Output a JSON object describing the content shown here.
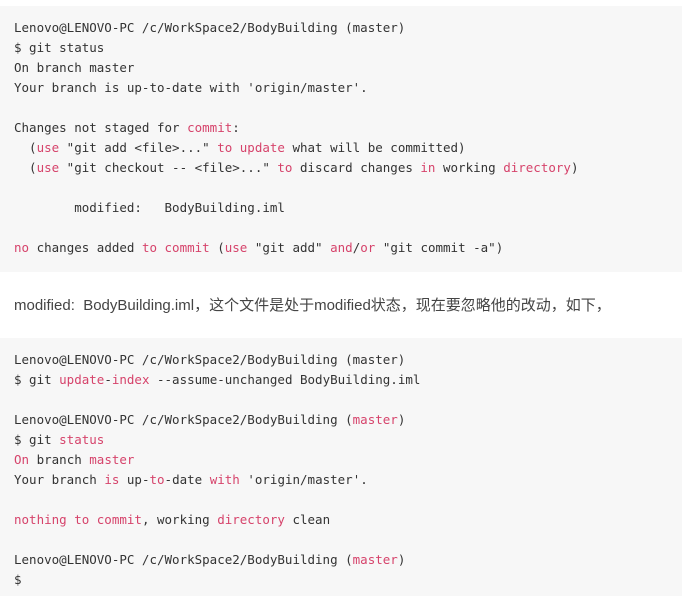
{
  "colors": {
    "code_background": "#f7f7f7",
    "page_background": "#ffffff",
    "code_text": "#333333",
    "keyword_highlight": "#d6436b",
    "prose_text": "#444444"
  },
  "code_block_1": {
    "name": "git-status-modified-output",
    "lines": [
      [
        {
          "t": "Lenovo@LENOVO-PC /c/WorkSpace2/BodyBuilding (master)",
          "k": false
        }
      ],
      [
        {
          "t": "$ git status",
          "k": false
        }
      ],
      [
        {
          "t": "On branch master",
          "k": false
        }
      ],
      [
        {
          "t": "Your branch is up-to-date with 'origin/master'.",
          "k": false
        }
      ],
      [],
      [
        {
          "t": "Changes not staged for ",
          "k": false
        },
        {
          "t": "commit",
          "k": true
        },
        {
          "t": ":",
          "k": false
        }
      ],
      [
        {
          "t": "  (",
          "k": false
        },
        {
          "t": "use",
          "k": true
        },
        {
          "t": " \"git add <file>...\" ",
          "k": false
        },
        {
          "t": "to update",
          "k": true
        },
        {
          "t": " what will be committed)",
          "k": false
        }
      ],
      [
        {
          "t": "  (",
          "k": false
        },
        {
          "t": "use",
          "k": true
        },
        {
          "t": " \"git checkout -- <file>...\" ",
          "k": false
        },
        {
          "t": "to",
          "k": true
        },
        {
          "t": " discard changes ",
          "k": false
        },
        {
          "t": "in",
          "k": true
        },
        {
          "t": " working ",
          "k": false
        },
        {
          "t": "directory",
          "k": true
        },
        {
          "t": ")",
          "k": false
        }
      ],
      [],
      [
        {
          "t": "        modified:   BodyBuilding.iml",
          "k": false
        }
      ],
      [],
      [
        {
          "t": "no",
          "k": true
        },
        {
          "t": " changes added ",
          "k": false
        },
        {
          "t": "to commit",
          "k": true
        },
        {
          "t": " (",
          "k": false
        },
        {
          "t": "use",
          "k": true
        },
        {
          "t": " \"git add\" ",
          "k": false
        },
        {
          "t": "and",
          "k": true
        },
        {
          "t": "/",
          "k": false
        },
        {
          "t": "or",
          "k": true
        },
        {
          "t": " \"git commit -a\")",
          "k": false
        }
      ]
    ]
  },
  "prose": {
    "text": "modified:  BodyBuilding.iml，这个文件是处于modified状态，现在要忽略他的改动，如下，"
  },
  "code_block_2": {
    "name": "git-update-index-assume-unchanged-output",
    "lines": [
      [
        {
          "t": "Lenovo@LENOVO-PC /c/WorkSpace2/BodyBuilding (master)",
          "k": false
        }
      ],
      [
        {
          "t": "$ git ",
          "k": false
        },
        {
          "t": "update",
          "k": true
        },
        {
          "t": "-",
          "k": false
        },
        {
          "t": "index",
          "k": true
        },
        {
          "t": " --assume-unchanged BodyBuilding.iml",
          "k": false
        }
      ],
      [],
      [
        {
          "t": "Lenovo@LENOVO-PC /c/WorkSpace2/BodyBuilding (",
          "k": false
        },
        {
          "t": "master",
          "k": true
        },
        {
          "t": ")",
          "k": false
        }
      ],
      [
        {
          "t": "$ git ",
          "k": false
        },
        {
          "t": "status",
          "k": true
        }
      ],
      [
        {
          "t": "On",
          "k": true
        },
        {
          "t": " branch ",
          "k": false
        },
        {
          "t": "master",
          "k": true
        }
      ],
      [
        {
          "t": "Your branch ",
          "k": false
        },
        {
          "t": "is",
          "k": true
        },
        {
          "t": " up-",
          "k": false
        },
        {
          "t": "to",
          "k": true
        },
        {
          "t": "-date ",
          "k": false
        },
        {
          "t": "with",
          "k": true
        },
        {
          "t": " 'origin/master'.",
          "k": false
        }
      ],
      [],
      [
        {
          "t": "nothing to commit",
          "k": true
        },
        {
          "t": ", working ",
          "k": false
        },
        {
          "t": "directory",
          "k": true
        },
        {
          "t": " clean",
          "k": false
        }
      ],
      [],
      [
        {
          "t": "Lenovo@LENOVO-PC /c/WorkSpace2/BodyBuilding (",
          "k": false
        },
        {
          "t": "master",
          "k": true
        },
        {
          "t": ")",
          "k": false
        }
      ],
      [
        {
          "t": "$",
          "k": false
        }
      ]
    ]
  }
}
